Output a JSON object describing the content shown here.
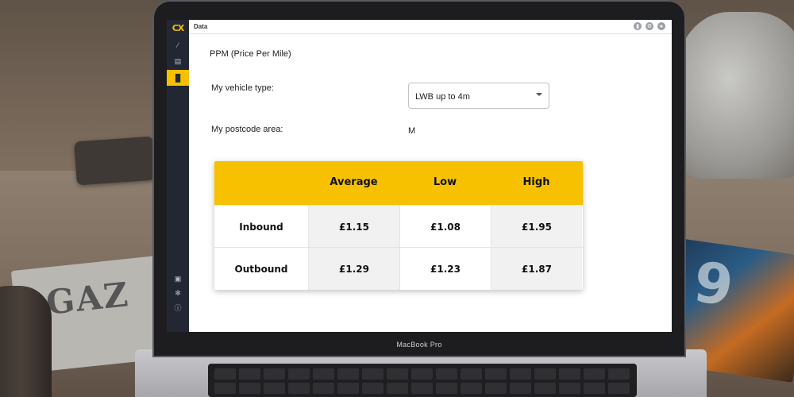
{
  "window": {
    "title": "Data"
  },
  "app": {
    "logo": "CX"
  },
  "device": {
    "label": "MacBook Pro"
  },
  "page": {
    "heading": "PPM (Price Per Mile)"
  },
  "form": {
    "vehicle_label": "My vehicle type:",
    "vehicle_value": "LWB up to 4m",
    "postcode_label": "My postcode area:",
    "postcode_value": "M"
  },
  "table": {
    "columns": [
      "Average",
      "Low",
      "High"
    ],
    "rows": [
      {
        "label": "Inbound",
        "values": [
          "£1.15",
          "£1.08",
          "£1.95"
        ]
      },
      {
        "label": "Outbound",
        "values": [
          "£1.29",
          "£1.23",
          "£1.87"
        ]
      }
    ]
  },
  "colors": {
    "accent": "#f7c100",
    "sidebar": "#232733"
  },
  "icons": {
    "sidebar": [
      "link-icon",
      "document-icon",
      "bar-chart-icon",
      "inbox-icon",
      "asterisk-icon",
      "help-icon"
    ],
    "topbar": [
      "user-icon",
      "gear-icon",
      "account-circle-icon"
    ]
  }
}
